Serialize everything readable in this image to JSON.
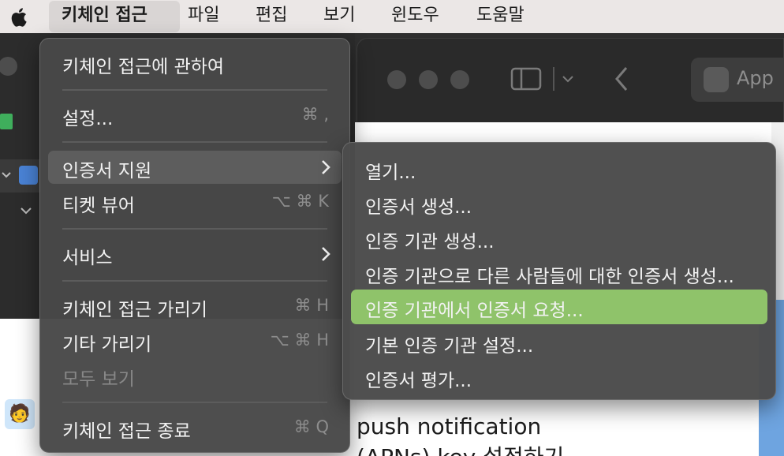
{
  "menubar": {
    "items": [
      "키체인 접근",
      "파일",
      "편집",
      "보기",
      "윈도우",
      "도움말"
    ]
  },
  "main_menu": {
    "items": [
      {
        "label": "키체인 접근에 관하여",
        "shortcut": ""
      },
      {
        "label": "설정...",
        "shortcut": "⌘ ,"
      },
      {
        "label": "인증서 지원",
        "shortcut": ""
      },
      {
        "label": "티켓 뷰어",
        "shortcut": "⌥ ⌘ K"
      },
      {
        "label": "서비스",
        "shortcut": ""
      },
      {
        "label": "키체인 접근 가리기",
        "shortcut": "⌘ H"
      },
      {
        "label": "기타 가리기",
        "shortcut": "⌥ ⌘ H"
      },
      {
        "label": "모두 보기",
        "shortcut": ""
      },
      {
        "label": "키체인 접근 종료",
        "shortcut": "⌘ Q"
      }
    ]
  },
  "submenu": {
    "items": [
      "열기...",
      "인증서 생성...",
      "인증 기관 생성...",
      "인증 기관으로 다른 사람들에 대한 인증서 생성...",
      "인증 기관에서 인증서 요청...",
      "기본 인증 기관 설정...",
      "인증서 평가..."
    ]
  },
  "background": {
    "app_button": "App",
    "text_line1": "push notification",
    "text_line2": "(APNs) key 설정하기"
  },
  "colors": {
    "selected": "#8fc36a",
    "menu_bg": "#484848"
  }
}
